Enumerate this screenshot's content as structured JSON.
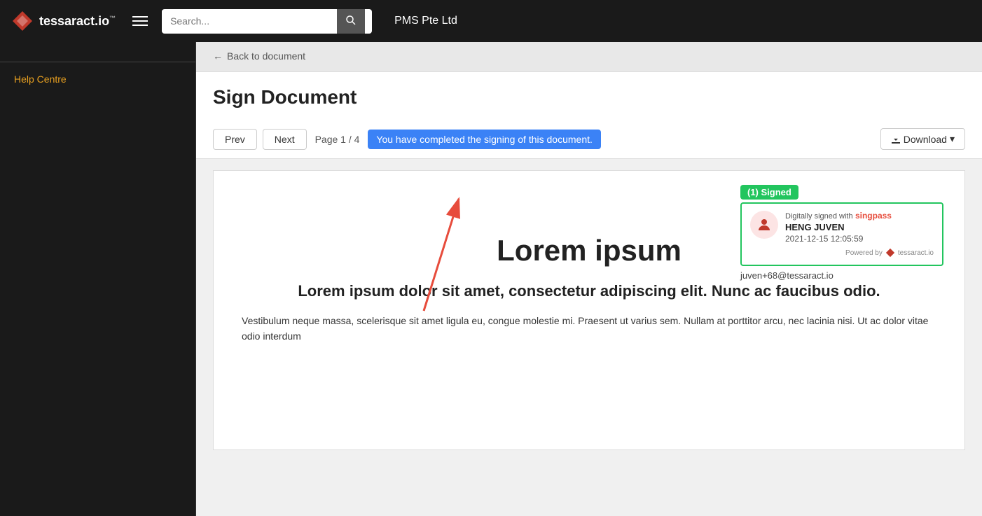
{
  "app": {
    "logo_text": "tessaract",
    "logo_suffix": ".io",
    "logo_tm": "™",
    "company": "PMS Pte Ltd"
  },
  "search": {
    "placeholder": "Search..."
  },
  "sidebar": {
    "help_label": "Help Centre"
  },
  "toolbar": {
    "back_label": "Back to document",
    "page_title": "Sign Document",
    "prev_label": "Prev",
    "next_label": "Next",
    "page_info": "Page 1 / 4",
    "completion_message": "You have completed the signing of this document.",
    "download_label": "Download"
  },
  "signed_block": {
    "badge": "(1) Signed",
    "signed_by_text": "Digitally signed with",
    "singpass_label": "singpass",
    "signer_name": "HENG JUVEN",
    "signed_date": "2021-12-15 12:05:59",
    "powered_by": "Powered by",
    "brand": "tessaract.io",
    "email": "juven+68@tessaract.io"
  },
  "document": {
    "main_title": "Lorem ipsum",
    "subtitle": "Lorem ipsum dolor sit amet, consectetur adipiscing elit. Nunc ac faucibus odio.",
    "body_text": "Vestibulum neque massa, scelerisque sit amet ligula eu, congue molestie mi. Praesent ut varius sem. Nullam at porttitor arcu, nec lacinia nisi. Ut ac dolor vitae odio interdum"
  }
}
